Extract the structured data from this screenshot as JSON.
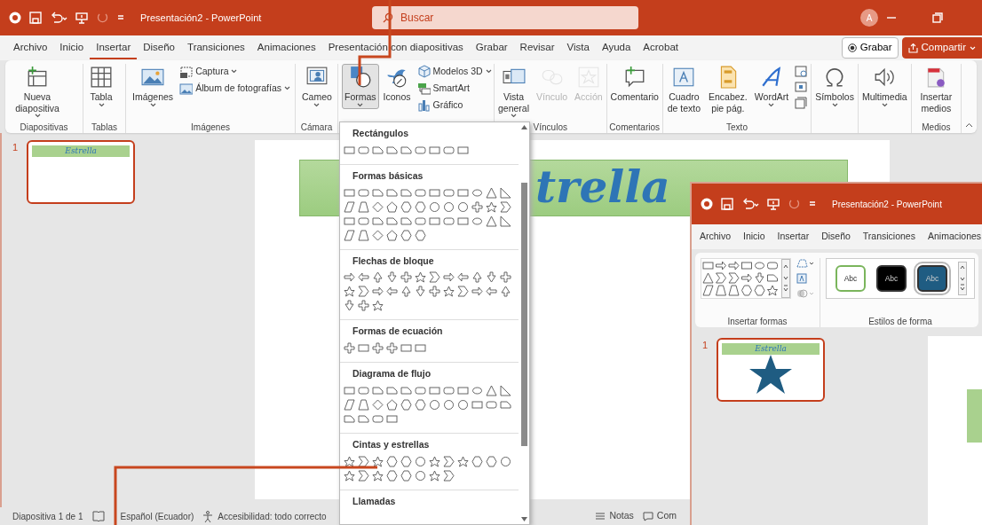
{
  "window": {
    "title": "Presentación2 - PowerPoint",
    "search_placeholder": "Buscar",
    "account_initial": "A"
  },
  "menu_tabs": [
    {
      "label": "Archivo",
      "selected": false
    },
    {
      "label": "Inicio",
      "selected": false
    },
    {
      "label": "Insertar",
      "selected": true
    },
    {
      "label": "Diseño",
      "selected": false
    },
    {
      "label": "Transiciones",
      "selected": false
    },
    {
      "label": "Animaciones",
      "selected": false
    },
    {
      "label": "Presentación con diapositivas",
      "selected": false
    },
    {
      "label": "Grabar",
      "selected": false
    },
    {
      "label": "Revisar",
      "selected": false
    },
    {
      "label": "Vista",
      "selected": false
    },
    {
      "label": "Ayuda",
      "selected": false
    },
    {
      "label": "Acrobat",
      "selected": false
    }
  ],
  "header_buttons": [
    {
      "label": "Grabar",
      "kind": "record"
    },
    {
      "label": "Compartir",
      "kind": "share"
    }
  ],
  "ribbon_groups": [
    {
      "label": "Diapositivas",
      "commands": [
        {
          "kind": "large",
          "label": "Nueva diapositiva",
          "dropdown": true,
          "pressed": false,
          "disabled": false
        }
      ]
    },
    {
      "label": "Tablas",
      "commands": [
        {
          "kind": "large",
          "label": "Tabla",
          "dropdown": true,
          "pressed": false,
          "disabled": false
        }
      ]
    },
    {
      "label": "Imágenes",
      "commands": [
        {
          "kind": "large",
          "label": "Imágenes",
          "dropdown": true,
          "pressed": false,
          "disabled": false
        },
        {
          "kind": "small",
          "label": "Captura",
          "dropdown": true,
          "pressed": false,
          "disabled": false
        },
        {
          "kind": "small",
          "label": "Álbum de fotografías",
          "dropdown": true,
          "pressed": false,
          "disabled": false
        }
      ]
    },
    {
      "label": "Cámara",
      "commands": [
        {
          "kind": "large",
          "label": "Cameo",
          "dropdown": true,
          "pressed": false,
          "disabled": false
        }
      ]
    },
    {
      "commands": [
        {
          "kind": "large",
          "label": "Formas",
          "dropdown": true,
          "pressed": true,
          "disabled": false
        },
        {
          "kind": "large",
          "label": "Iconos",
          "dropdown": false,
          "pressed": false,
          "disabled": false
        },
        {
          "kind": "small",
          "label": "Modelos 3D",
          "dropdown": true,
          "pressed": false,
          "disabled": false
        },
        {
          "kind": "small",
          "label": "SmartArt",
          "dropdown": false,
          "pressed": false,
          "disabled": false
        },
        {
          "kind": "small",
          "label": "Gráfico",
          "dropdown": false,
          "pressed": false,
          "disabled": false
        }
      ]
    },
    {
      "label": "Vínculos",
      "commands": [
        {
          "kind": "large",
          "label": "Vista general",
          "dropdown": true,
          "pressed": false,
          "disabled": false
        },
        {
          "kind": "large",
          "label": "Vínculo",
          "dropdown": false,
          "pressed": false,
          "disabled": true
        },
        {
          "kind": "large",
          "label": "Acción",
          "dropdown": false,
          "pressed": false,
          "disabled": true
        }
      ]
    },
    {
      "label": "Comentarios",
      "commands": [
        {
          "kind": "large",
          "label": "Comentario",
          "dropdown": false,
          "pressed": false,
          "disabled": false
        }
      ]
    },
    {
      "label": "Texto",
      "commands": [
        {
          "kind": "large",
          "label": "Cuadro de texto",
          "dropdown": false,
          "pressed": false,
          "disabled": false
        },
        {
          "kind": "large",
          "label": "Encabez. pie pág.",
          "dropdown": false,
          "pressed": false,
          "disabled": false
        },
        {
          "kind": "large",
          "label": "WordArt",
          "dropdown": true,
          "pressed": false,
          "disabled": false
        },
        {
          "kind": "icon",
          "dropdown": false,
          "pressed": false,
          "disabled": false
        },
        {
          "kind": "icon",
          "dropdown": false,
          "pressed": false,
          "disabled": false
        },
        {
          "kind": "icon",
          "dropdown": false,
          "pressed": false,
          "disabled": false
        }
      ]
    },
    {
      "commands": [
        {
          "kind": "large",
          "label": "Símbolos",
          "dropdown": true,
          "pressed": false,
          "disabled": false
        }
      ]
    },
    {
      "commands": [
        {
          "kind": "large",
          "label": "Multimedia",
          "dropdown": true,
          "pressed": false,
          "disabled": false
        }
      ]
    },
    {
      "label": "Medios",
      "commands": [
        {
          "kind": "large",
          "label": "Insertar medios",
          "dropdown": false,
          "pressed": false,
          "disabled": false
        }
      ]
    }
  ],
  "thumbnails": [
    {
      "number": "1",
      "title": "Estrella",
      "selected": true
    }
  ],
  "slide": {
    "title": "trella"
  },
  "shapes_menu": {
    "sections": [
      {
        "title": "Rectángulos"
      },
      {
        "title": "Formas básicas"
      },
      {
        "title": "Flechas de bloque"
      },
      {
        "title": "Formas de ecuación"
      },
      {
        "title": "Diagrama de flujo"
      },
      {
        "title": "Cintas y estrellas"
      },
      {
        "title": "Llamadas"
      }
    ]
  },
  "status_bar": {
    "slide_info": "Diapositiva 1 de 1",
    "language": "Español (Ecuador)",
    "accessibility": "Accesibilidad: todo correcto",
    "notes": "Notas",
    "comments": "Com"
  },
  "inset_window": {
    "title": "Presentación2 - PowerPoint",
    "menu_tabs": [
      {
        "label": "Archivo",
        "selected": false
      },
      {
        "label": "Inicio",
        "selected": false
      },
      {
        "label": "Insertar",
        "selected": false
      },
      {
        "label": "Diseño",
        "selected": false
      },
      {
        "label": "Transiciones",
        "selected": false
      },
      {
        "label": "Animaciones",
        "selected": false
      }
    ],
    "groups": [
      {
        "label": "Insertar formas"
      },
      {
        "label": "Estilos de forma"
      }
    ],
    "style_swatches": [
      {
        "label": "Abc",
        "color": "#ffffff",
        "selected": false
      },
      {
        "label": "Abc",
        "color": "#000000",
        "selected": false
      },
      {
        "label": "Abc",
        "color": "#1f5c82",
        "selected": true
      }
    ],
    "thumbnails": [
      {
        "number": "1",
        "title": "Estrella",
        "selected": true
      }
    ]
  }
}
